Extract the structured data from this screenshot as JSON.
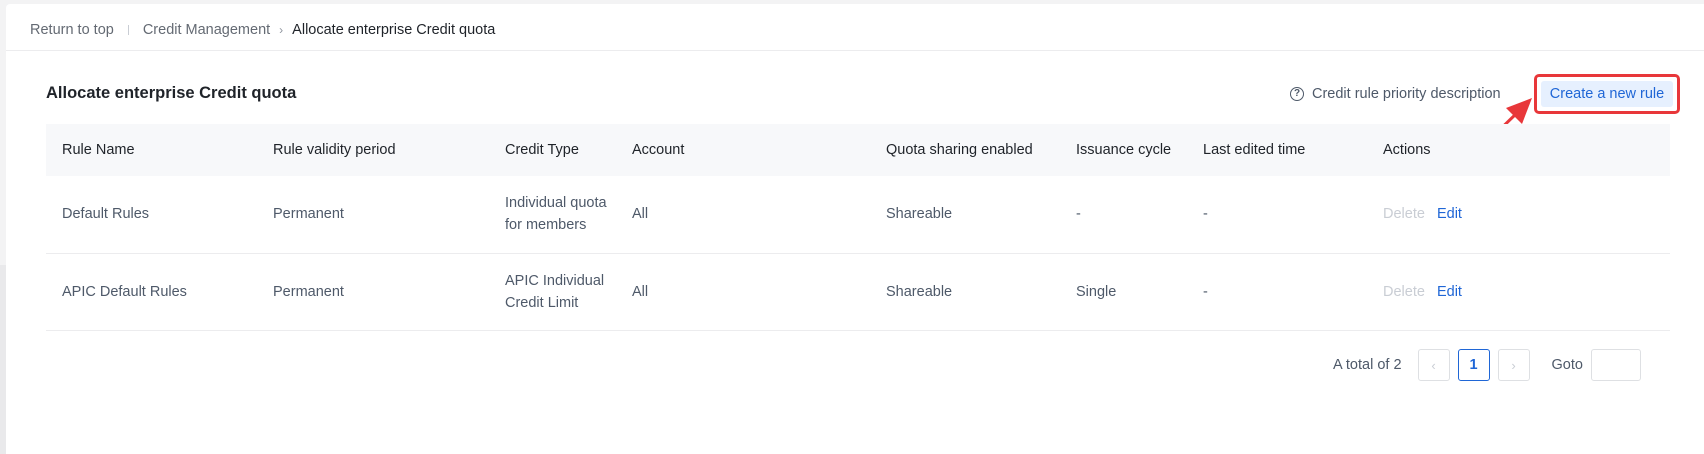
{
  "breadcrumb": {
    "return_label": "Return to top",
    "parent_label": "Credit Management",
    "current_label": "Allocate enterprise Credit quota"
  },
  "page": {
    "title": "Allocate enterprise Credit quota",
    "priority_link": "Credit rule priority description",
    "create_button": "Create a new rule"
  },
  "table": {
    "headers": [
      "Rule Name",
      "Rule validity period",
      "Credit Type",
      "Account",
      "Quota sharing enabled",
      "Issuance cycle",
      "Last edited time",
      "Actions"
    ],
    "rows": [
      {
        "rule_name": "Default Rules",
        "validity": "Permanent",
        "credit_type_line1": "Individual quota",
        "credit_type_line2": "for members",
        "account": "All",
        "sharing": "Shareable",
        "cycle": "-",
        "edited": "-",
        "delete": "Delete",
        "edit": "Edit"
      },
      {
        "rule_name": "APIC Default Rules",
        "validity": "Permanent",
        "credit_type_line1": "APIC Individual",
        "credit_type_line2": "Credit Limit",
        "account": "All",
        "sharing": "Shareable",
        "cycle": "Single",
        "edited": "-",
        "delete": "Delete",
        "edit": "Edit"
      }
    ]
  },
  "pagination": {
    "total_label": "A total of 2",
    "current_page": "1",
    "prev_glyph": "‹",
    "next_glyph": "›",
    "goto_label": "Goto",
    "goto_value": ""
  },
  "colors": {
    "accent": "#1f66d6",
    "highlight": "#e8373a"
  },
  "icons": {
    "priority": "question-circle-icon",
    "annotation": "red-arrow-icon"
  }
}
